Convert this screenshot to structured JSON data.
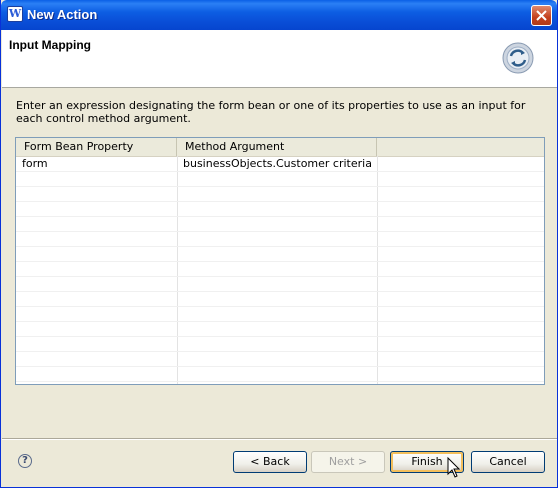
{
  "window": {
    "title": "New Action",
    "app_icon_letter": "W",
    "close_icon": "close-icon"
  },
  "header": {
    "title": "Input Mapping",
    "icon": "refresh-cycle-icon"
  },
  "description": "Enter an expression designating the form bean or one of its properties to use as an input for each control method argument.",
  "table": {
    "columns": [
      "Form Bean Property",
      "Method Argument",
      ""
    ],
    "rows": [
      [
        "form",
        "businessObjects.Customer criteria",
        ""
      ]
    ]
  },
  "footer": {
    "help_icon": "?",
    "back_label": "< Back",
    "next_label": "Next >",
    "finish_label": "Finish",
    "cancel_label": "Cancel"
  },
  "colors": {
    "titlebar": "#0a5fe6",
    "dialog_bg": "#ece9d8",
    "default_button_focus": "#f3bf5c"
  }
}
